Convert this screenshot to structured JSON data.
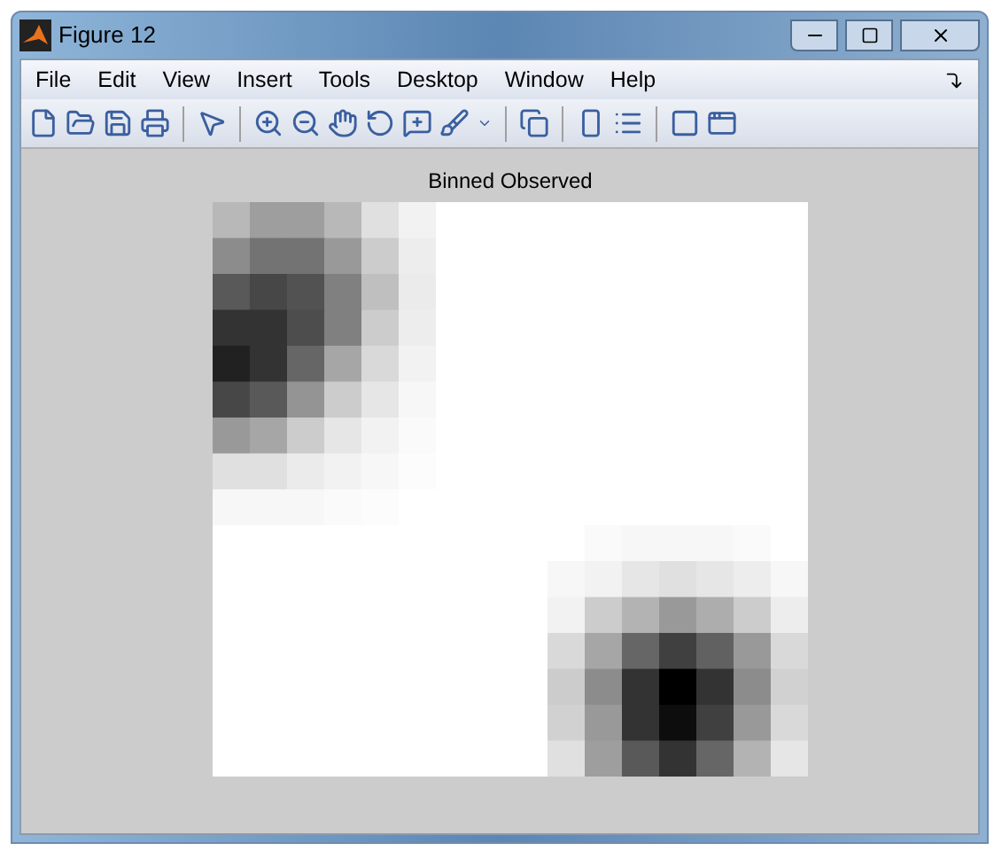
{
  "window": {
    "title": "Figure 12"
  },
  "menu": [
    "File",
    "Edit",
    "View",
    "Insert",
    "Tools",
    "Desktop",
    "Window",
    "Help"
  ],
  "axes": {
    "title": "Binned Observed"
  }
}
